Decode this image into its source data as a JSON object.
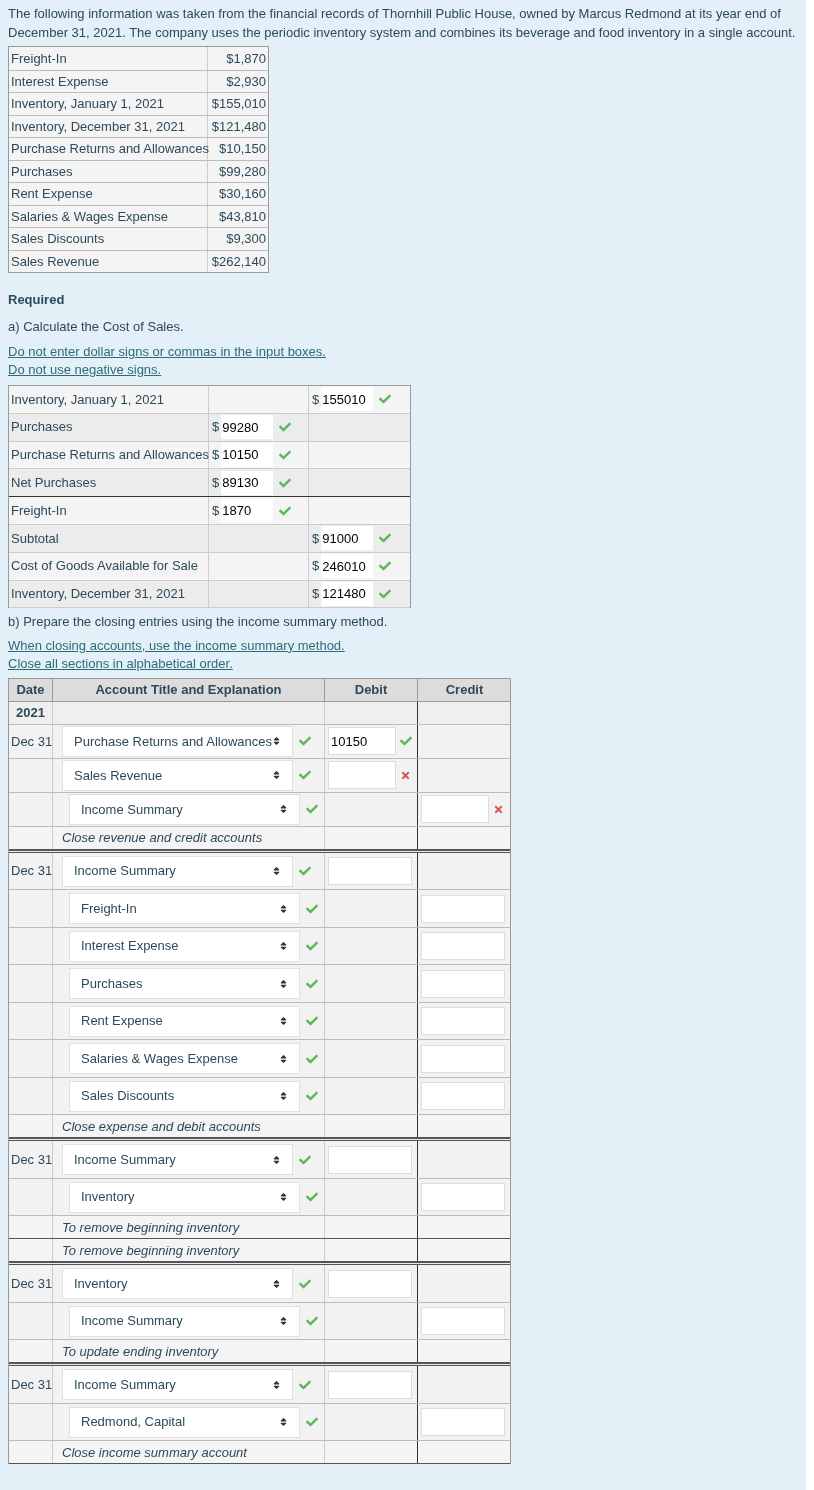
{
  "intro": "The following information was taken from the financial records of Thornhill Public House, owned by Marcus Redmond at its year end of December 31, 2021. The company uses the periodic inventory system and combines its beverage and food inventory in a single account.",
  "given": [
    {
      "label": "Freight-In",
      "value": "$1,870"
    },
    {
      "label": "Interest Expense",
      "value": "$2,930"
    },
    {
      "label": "Inventory, January 1, 2021",
      "value": "$155,010"
    },
    {
      "label": "Inventory, December 31, 2021",
      "value": "$121,480"
    },
    {
      "label": "Purchase Returns and Allowances",
      "value": "$10,150"
    },
    {
      "label": "Purchases",
      "value": "$99,280"
    },
    {
      "label": "Rent Expense",
      "value": "$30,160"
    },
    {
      "label": "Salaries & Wages Expense",
      "value": "$43,810"
    },
    {
      "label": "Sales Discounts",
      "value": "$9,300"
    },
    {
      "label": "Sales Revenue",
      "value": "$262,140"
    }
  ],
  "required": "Required",
  "part_a": {
    "prompt": "a) Calculate the Cost of Sales.",
    "instructions": [
      "Do not enter dollar signs or commas in the input boxes.",
      "Do not use negative signs."
    ],
    "rows": [
      {
        "label": "Inventory, January 1, 2021",
        "kind": "total",
        "currency": "$",
        "value": "155010",
        "correct": true
      },
      {
        "label": "Purchases",
        "kind": "item",
        "currency": "$",
        "value": "99280",
        "correct": true
      },
      {
        "label": "Purchase Returns and Allowances",
        "kind": "item",
        "currency": "$",
        "value": "10150",
        "correct": true
      },
      {
        "label": "Net Purchases",
        "kind": "item",
        "currency": "$",
        "value": "89130",
        "correct": true
      },
      {
        "label": "Freight-In",
        "kind": "item",
        "currency": "$",
        "value": "1870",
        "correct": true
      },
      {
        "label": "Subtotal",
        "kind": "total",
        "currency": "$",
        "value": "91000",
        "correct": true
      },
      {
        "label": "Cost of Goods Available for Sale",
        "kind": "total",
        "currency": "$",
        "value": "246010",
        "correct": true
      },
      {
        "label": "Inventory, December 31, 2021",
        "kind": "total",
        "currency": "$",
        "value": "121480",
        "correct": true
      }
    ]
  },
  "part_b": {
    "prompt": "b) Prepare the closing entries using the income summary method.",
    "instructions": [
      "When closing accounts, use the income summary method.",
      "Close all sections in alphabetical order."
    ],
    "columns": [
      "Date",
      "Account Title and Explanation",
      "Debit",
      "Credit"
    ],
    "year": "2021",
    "entries": [
      {
        "date": "Dec 31",
        "lines": [
          {
            "account": "Purchase Returns and Allowances",
            "kind": "debit",
            "account_correct": true,
            "amount": "10150",
            "amount_correct": true
          },
          {
            "account": "Sales Revenue",
            "kind": "debit",
            "account_correct": true,
            "amount_correct": false
          },
          {
            "account": "Income Summary",
            "kind": "credit",
            "account_correct": true,
            "amount_correct": false
          }
        ],
        "explanations": [
          "Close revenue and credit accounts"
        ]
      },
      {
        "date": "Dec 31",
        "lines": [
          {
            "account": "Income Summary",
            "kind": "debit",
            "account_correct": true
          },
          {
            "account": "Freight-In",
            "kind": "credit",
            "account_correct": true
          },
          {
            "account": "Interest Expense",
            "kind": "credit",
            "account_correct": true
          },
          {
            "account": "Purchases",
            "kind": "credit",
            "account_correct": true
          },
          {
            "account": "Rent Expense",
            "kind": "credit",
            "account_correct": true
          },
          {
            "account": "Salaries & Wages Expense",
            "kind": "credit",
            "account_correct": true
          },
          {
            "account": "Sales Discounts",
            "kind": "credit",
            "account_correct": true
          }
        ],
        "explanations": [
          "Close expense and debit accounts"
        ]
      },
      {
        "date": "Dec 31",
        "lines": [
          {
            "account": "Income Summary",
            "kind": "debit",
            "account_correct": true
          },
          {
            "account": "Inventory",
            "kind": "credit",
            "account_correct": true
          }
        ],
        "explanations": [
          "To remove beginning inventory",
          "To remove beginning inventory"
        ]
      },
      {
        "date": "Dec 31",
        "lines": [
          {
            "account": "Inventory",
            "kind": "debit",
            "account_correct": true
          },
          {
            "account": "Income Summary",
            "kind": "credit",
            "account_correct": true
          }
        ],
        "explanations": [
          "To update ending inventory"
        ]
      },
      {
        "date": "Dec 31",
        "lines": [
          {
            "account": "Income Summary",
            "kind": "debit",
            "account_correct": true
          },
          {
            "account": "Redmond, Capital",
            "kind": "credit",
            "account_correct": true
          }
        ],
        "explanations": [
          "Close income summary account"
        ]
      }
    ]
  }
}
